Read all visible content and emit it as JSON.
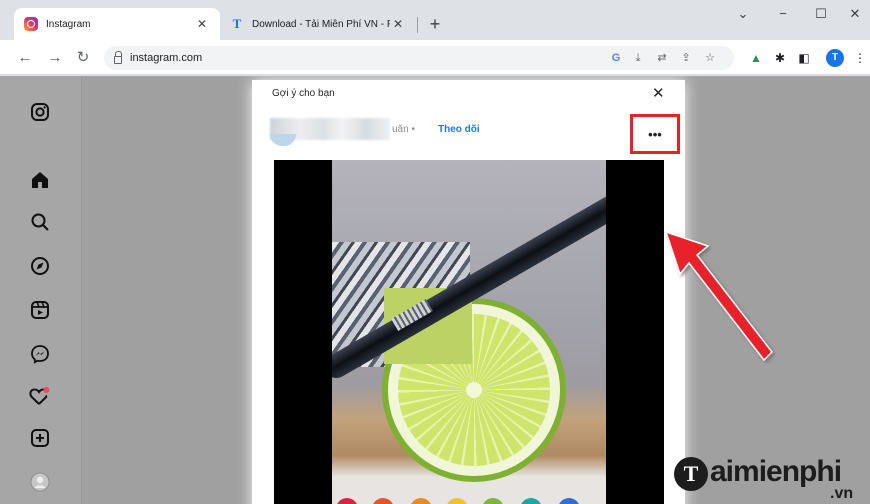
{
  "browser": {
    "tabs": [
      {
        "title": "Instagram",
        "favicon": "instagram-icon",
        "active": true
      },
      {
        "title": "Download - Tải Miễn Phí VN - Ph",
        "favicon": "t-letter-icon",
        "active": false
      }
    ],
    "new_tab_symbol": "+",
    "tab_close_symbol": "✕",
    "window_controls": {
      "dropdown": "⌄",
      "minimize": "−",
      "maximize": "☐",
      "close": "✕"
    },
    "address": "instagram.com",
    "profile_initial": "T",
    "extension_icons": [
      "google-icon",
      "download-icon",
      "translate-icon",
      "share-icon",
      "star-icon",
      "drive-icon",
      "puzzle-icon",
      "sidepanel-icon"
    ],
    "menu_symbol": "⋮"
  },
  "sidebar": {
    "items": [
      "instagram-logo-icon",
      "home-icon",
      "search-icon",
      "explore-icon",
      "reels-icon",
      "messenger-icon",
      "notifications-heart-icon",
      "create-icon",
      "profile-icon"
    ],
    "notification_dot_color": "#ed4956"
  },
  "modal": {
    "title": "Gợi ý cho bạn",
    "close_symbol": "✕",
    "username_suffix": "uăn •",
    "follow_label": "Theo dõi",
    "more_options": "•••",
    "highlight_color": "#e8202a",
    "follow_color": "#1877f2"
  },
  "watermark": {
    "letter": "T",
    "name": "aimienphi",
    "domain": ".vn"
  }
}
